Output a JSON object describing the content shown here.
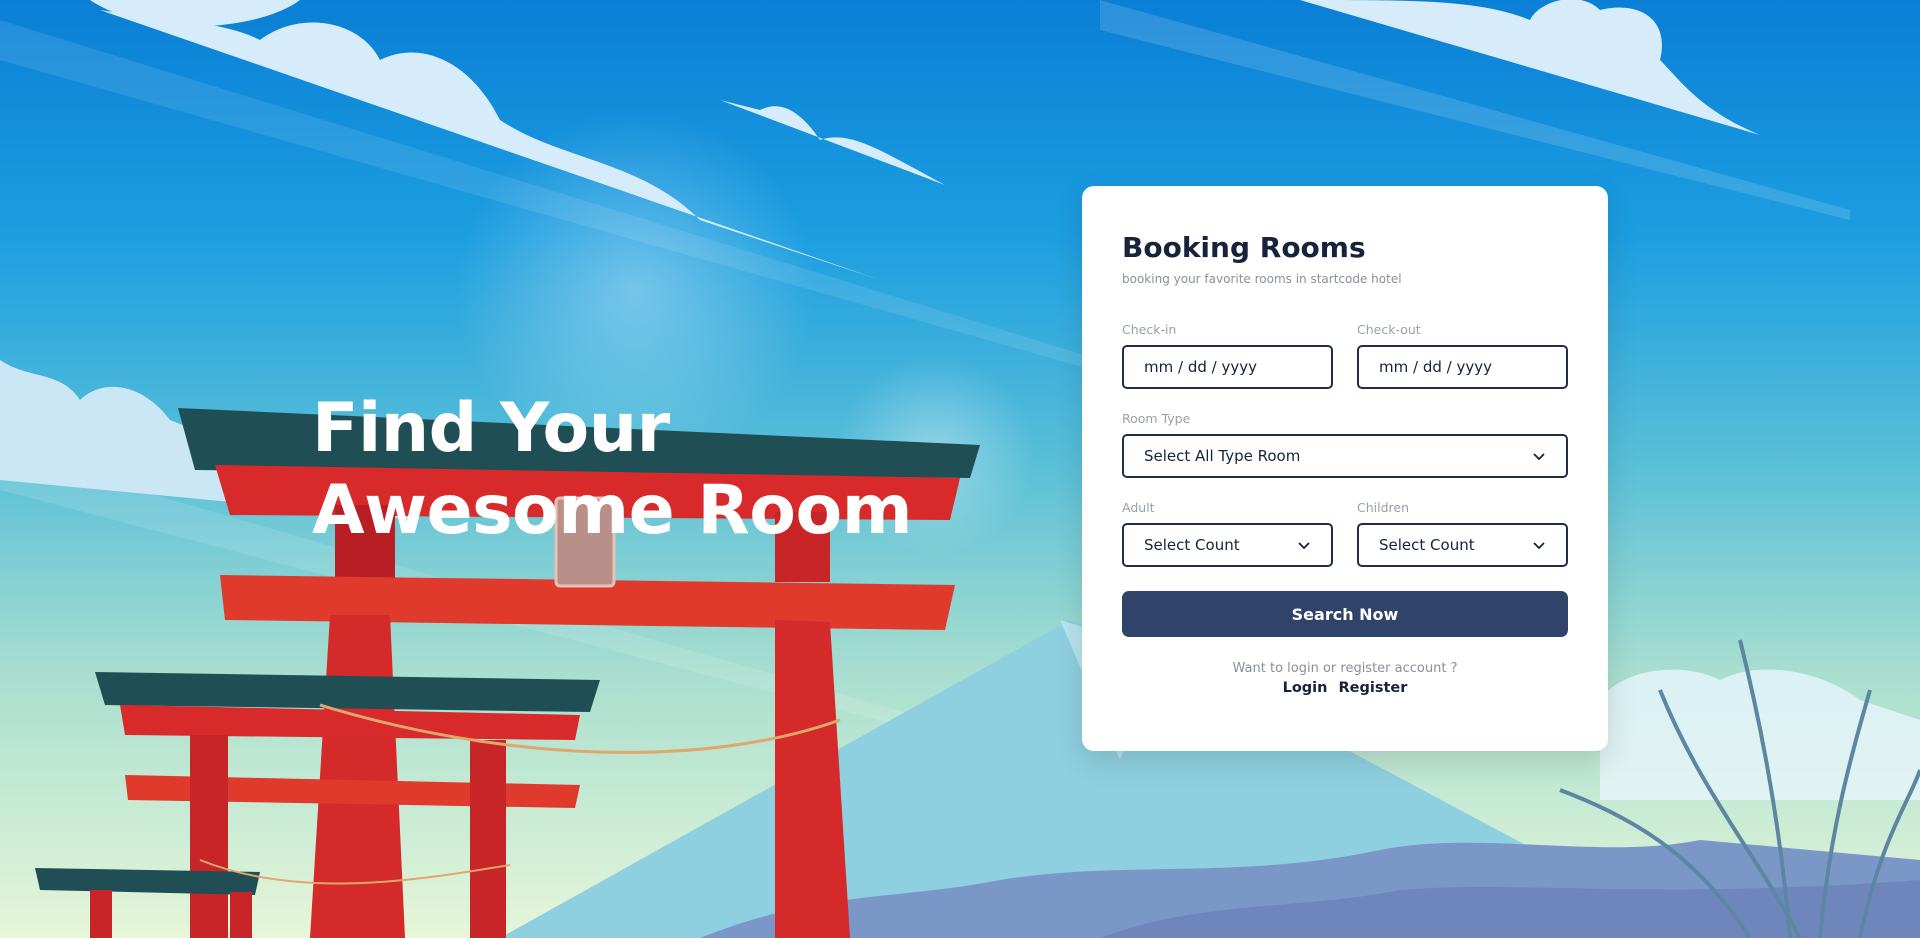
{
  "hero": {
    "title": "Find Your Awesome Room"
  },
  "booking": {
    "title": "Booking Rooms",
    "subtitle": "booking your favorite rooms in startcode hotel",
    "checkin": {
      "label": "Check-in",
      "value": "mm / dd / yyyy"
    },
    "checkout": {
      "label": "Check-out",
      "value": "mm / dd / yyyy"
    },
    "room_type": {
      "label": "Room Type",
      "selected": "Select All Type Room"
    },
    "adult": {
      "label": "Adult",
      "selected": "Select Count"
    },
    "children": {
      "label": "Children",
      "selected": "Select Count"
    },
    "search_label": "Search Now",
    "account_prompt": "Want to login or register account ?",
    "login_label": "Login",
    "register_label": "Register"
  },
  "colors": {
    "sky_top": "#0a7fd6",
    "sky_bottom": "#e6f6d9",
    "torii_red": "#d82a2a",
    "roof_dark": "#1f4f55",
    "card_text": "#16233a",
    "control_border": "#1f2d4d",
    "button_bg": "#2f4468"
  },
  "icons": {
    "select_arrow": "chevron-down-icon"
  }
}
